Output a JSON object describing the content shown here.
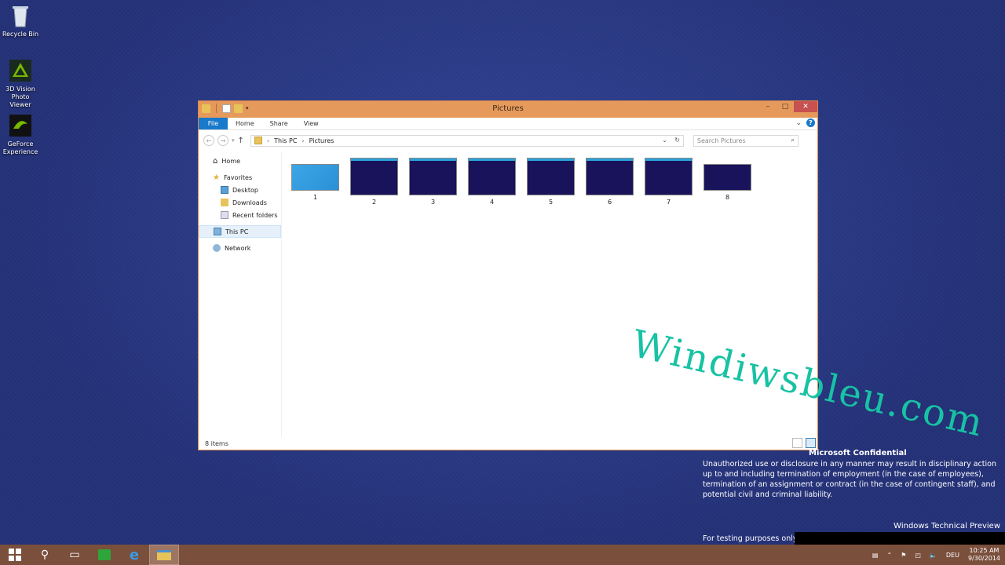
{
  "desktop": {
    "icons": [
      {
        "label": "Recycle Bin",
        "icon": "recycle-bin-icon"
      },
      {
        "label": "3D Vision\nPhoto Viewer",
        "icon": "3d-vision-icon"
      },
      {
        "label": "GeForce\nExperience",
        "icon": "geforce-icon"
      }
    ]
  },
  "window": {
    "title": "Pictures",
    "ribbon_tabs": [
      "File",
      "Home",
      "Share",
      "View"
    ],
    "address": {
      "root": "This PC",
      "current": "Pictures"
    },
    "search_placeholder": "Search Pictures",
    "nav": {
      "home": "Home",
      "favorites": "Favorites",
      "desktop": "Desktop",
      "downloads": "Downloads",
      "recent": "Recent folders",
      "this_pc": "This PC",
      "network": "Network"
    },
    "items": [
      "1",
      "2",
      "3",
      "4",
      "5",
      "6",
      "7",
      "8"
    ],
    "status": "8 items"
  },
  "watermark": "Windiwsbleu.com",
  "notice": {
    "title": "Microsoft Confidential",
    "body": "Unauthorized use or disclosure in any manner may result in disciplinary action up to and including termination of employment (in the case of employees), termination of an assignment or contract (in the case of contingent staff), and potential civil and criminal liability.",
    "edition": "Windows Technical Preview",
    "testing": "For testing purposes only. I"
  },
  "taskbar": {
    "language": "DEU",
    "time": "10:25 AM",
    "date": "9/30/2014"
  },
  "colors": {
    "accent": "#1979ca",
    "titlebar": "#e59a5c",
    "taskbar": "#7a4f3c",
    "watermark": "#18c2a4"
  }
}
